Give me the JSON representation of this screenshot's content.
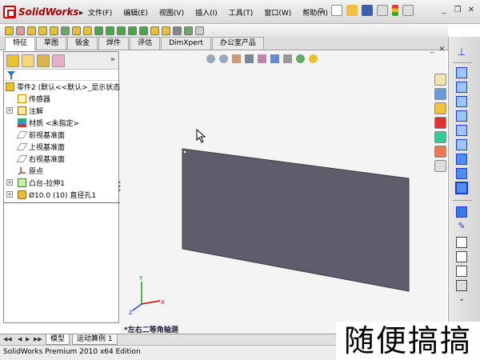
{
  "app": {
    "logo_text": "SolidWorks",
    "status_text": "SolidWorks Premium 2010 x64 Edition"
  },
  "menu": {
    "items": [
      "文件(F)",
      "编辑(E)",
      "视图(V)",
      "插入(I)",
      "工具(T)",
      "窗口(W)",
      "帮助(H)"
    ]
  },
  "command_tabs": [
    "特征",
    "草图",
    "钣金",
    "焊件",
    "评估",
    "DimXpert",
    "办公室产品"
  ],
  "active_tab": "特征",
  "feature_tree": {
    "root": "零件2 (默认<<默认>_显示状态",
    "items": [
      {
        "label": "传感器",
        "icon": "sensor-icon",
        "expandable": false
      },
      {
        "label": "注解",
        "icon": "annotation-icon",
        "expandable": true
      },
      {
        "label": "材质 <未指定>",
        "icon": "material-icon",
        "expandable": false
      },
      {
        "label": "前视基准面",
        "icon": "plane-icon",
        "expandable": false
      },
      {
        "label": "上视基准面",
        "icon": "plane-icon",
        "expandable": false
      },
      {
        "label": "右视基准面",
        "icon": "plane-icon",
        "expandable": false
      },
      {
        "label": "原点",
        "icon": "origin-icon",
        "expandable": false
      }
    ],
    "features": [
      {
        "label": "凸台-拉伸1",
        "icon": "boss-extrude-icon",
        "expandable": true
      },
      {
        "label": "Ø10.0 (10) 直径孔1",
        "icon": "hole-icon",
        "expandable": true
      }
    ]
  },
  "graphics": {
    "view_label": "*左右二等角轴测",
    "plate_color": "#5d5d6b"
  },
  "bottom_tabs": [
    "模型",
    "运动算例 1"
  ],
  "active_bottom_tab": "模型",
  "watermark": "随便搞搞",
  "colors": {
    "selection": "#3a74c9",
    "accent_red": "#c00000"
  }
}
